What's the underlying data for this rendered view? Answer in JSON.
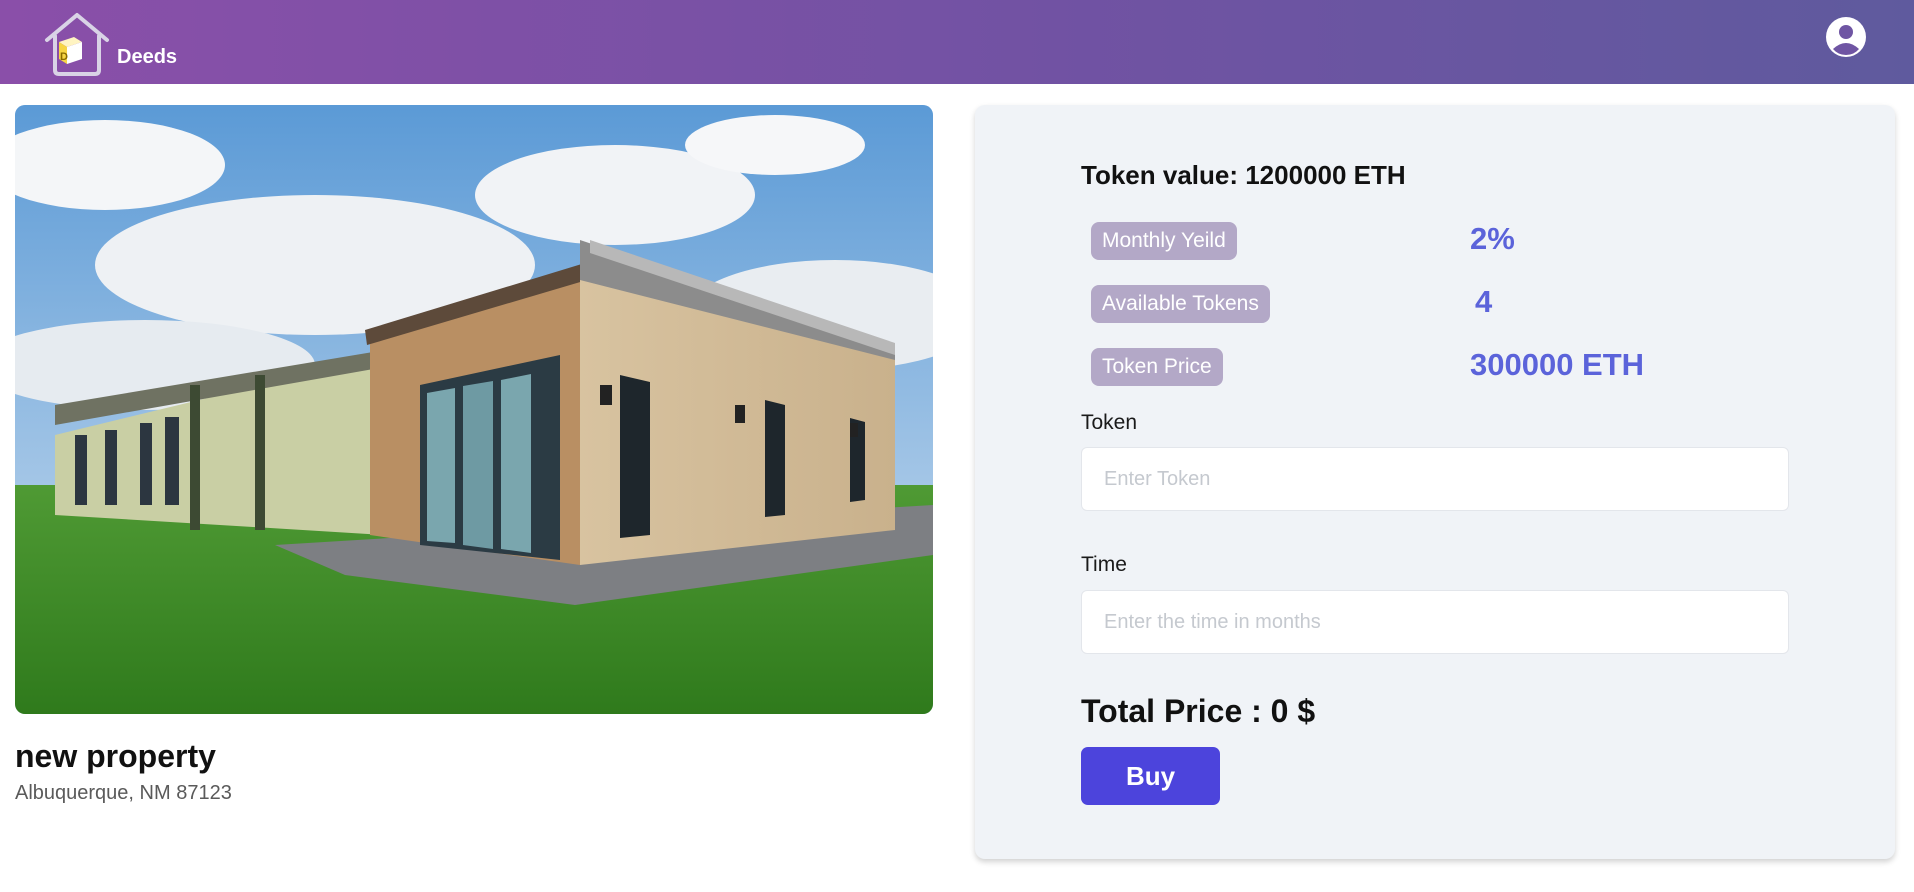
{
  "header": {
    "brand": "Deeds",
    "logo_letter": "D",
    "logo_icon": "house-logo-icon",
    "profile_icon": "user-avatar-icon",
    "gradient_start": "#8a4fa9",
    "gradient_end": "#5f5a9e"
  },
  "property": {
    "title": "new property",
    "address": "Albuquerque, NM 87123"
  },
  "panel": {
    "token_value": "Token value: 1200000 ETH",
    "stats": [
      {
        "label": "Monthly Yeild",
        "value": "2%"
      },
      {
        "label": "Available Tokens",
        "value": "4"
      },
      {
        "label": "Token Price",
        "value": "300000 ETH"
      }
    ],
    "token_field": {
      "label": "Token",
      "placeholder": "Enter Token",
      "value": ""
    },
    "time_field": {
      "label": "Time",
      "placeholder": "Enter the time in months",
      "value": ""
    },
    "total_price": "Total Price : 0 $",
    "buy_label": "Buy",
    "accent_color": "#4c44dc",
    "stat_value_color": "#5b63da"
  }
}
